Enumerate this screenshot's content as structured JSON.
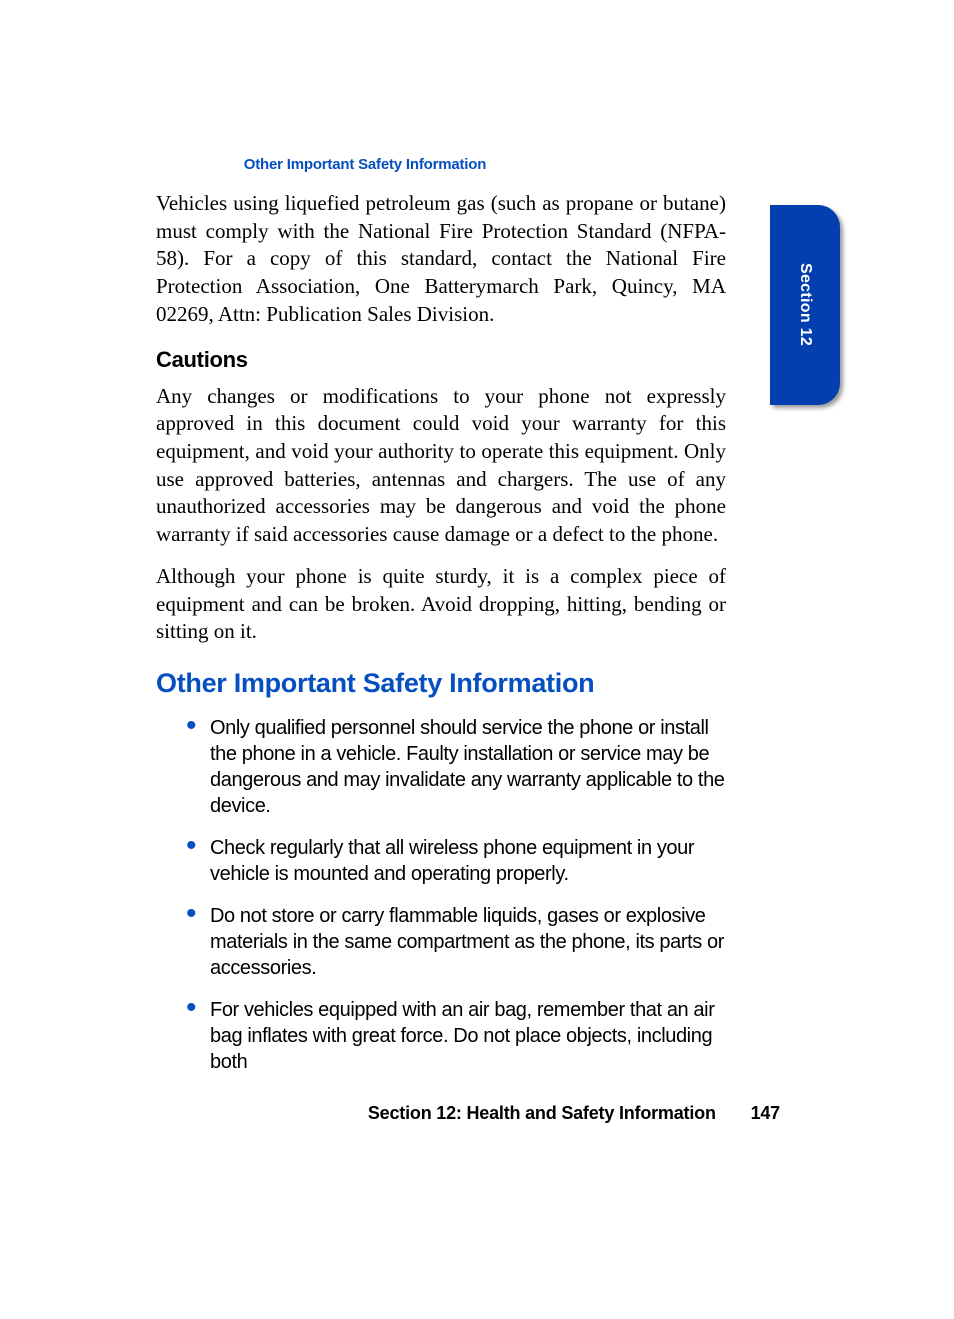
{
  "running_header": "Other Important Safety Information",
  "tab_label": "Section 12",
  "body": {
    "intro_paragraph": "Vehicles using liquefied petroleum gas (such as propane or butane) must comply with the National Fire Protection Standard (NFPA-58). For a copy of this standard, contact the National Fire Protection Association, One Batterymarch Park, Quincy, MA 02269, Attn: Publication Sales Division.",
    "cautions_heading": "Cautions",
    "cautions_p1": "Any changes or modifications to your phone not expressly approved in this document could void your warranty for this equipment, and void your authority to operate this equipment. Only use approved batteries, antennas and chargers. The use of any unauthorized accessories may be dangerous and void the phone warranty if said accessories cause damage or a defect to the phone.",
    "cautions_p2": "Although your phone is quite sturdy, it is a complex piece of equipment and can be broken. Avoid dropping, hitting, bending or sitting on it.",
    "section_heading": "Other Important Safety Information",
    "bullets": [
      "Only qualified personnel should service the phone or install the phone in a vehicle. Faulty installation or service may be dangerous and may invalidate any warranty applicable to the device.",
      "Check regularly that all wireless phone equipment in your vehicle is mounted and operating properly.",
      "Do not store or carry flammable liquids, gases or explosive materials in the same compartment as the phone, its parts or accessories.",
      "For vehicles equipped with an air bag, remember that an air bag inflates with great force. Do not place objects, including both"
    ]
  },
  "footer": {
    "section_label": "Section 12: Health and Safety Information",
    "page_number": "147"
  }
}
